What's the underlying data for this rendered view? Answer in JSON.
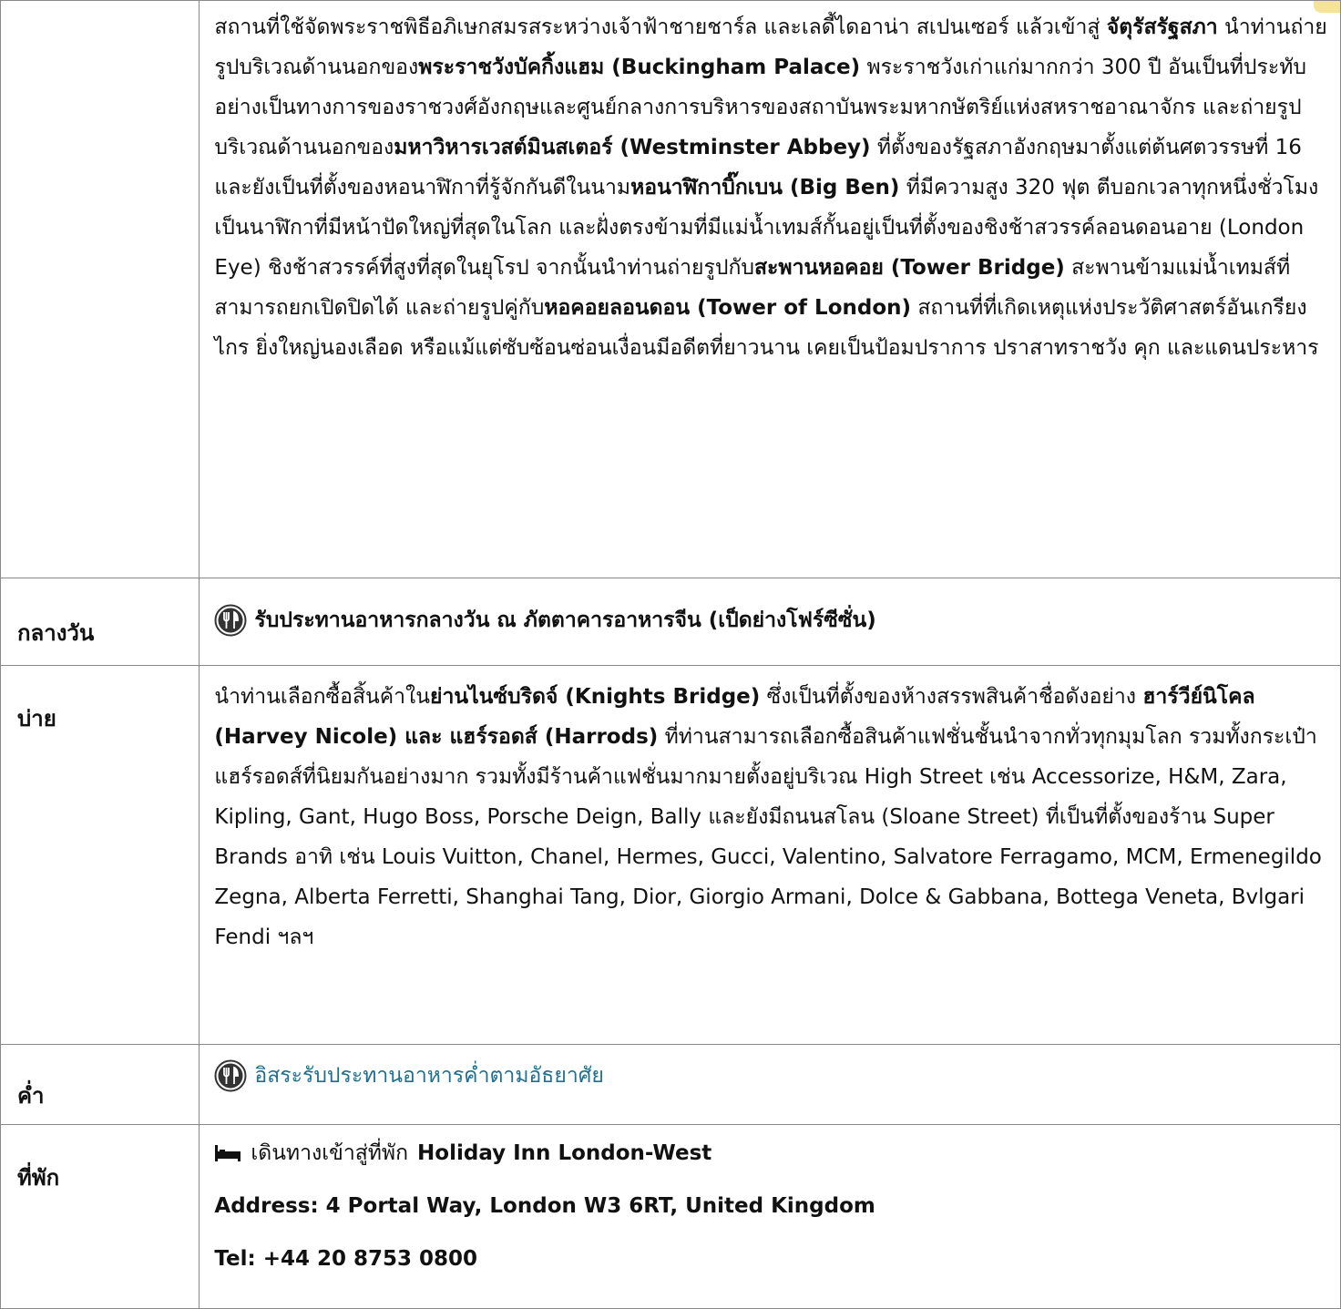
{
  "colors": {
    "border": "#8a8a8a",
    "dinner_link": "#1f6f91",
    "corner_tab": "#f6e39a"
  },
  "rows": {
    "morning": {
      "label": "",
      "segments": [
        {
          "text": "สถานที่ใช้จัดพระราชพิธีอภิเษกสมรสระหว่างเจ้าฟ้าชายชาร์ล และเลดี้ไดอาน่า สเปนเซอร์ แล้วเข้าสู่ ",
          "bold": false
        },
        {
          "text": "จัตุรัสรัฐสภา",
          "bold": true
        },
        {
          "text": " นำท่านถ่ายรูปบริเวณด้านนอกของ",
          "bold": false
        },
        {
          "text": "พระราชวังบัคกิ้งแฮม (Buckingham Palace)",
          "bold": true
        },
        {
          "text": " พระราชวังเก่าแก่มากกว่า 300 ปี อันเป็นที่ประทับอย่างเป็นทางการของราชวงศ์อังกฤษและศูนย์กลางการบริหารของสถาบันพระมหากษัตริย์แห่งสหราชอาณาจักร และถ่ายรูปบริเวณด้านนอกของ",
          "bold": false
        },
        {
          "text": "มหาวิหารเวสต์มินสเตอร์ (Westminster Abbey)",
          "bold": true
        },
        {
          "text": " ที่ตั้งของรัฐสภาอังกฤษมาตั้งแต่ต้นศตวรรษที่ 16 และยังเป็นที่ตั้งของหอนาฬิกาที่รู้จักกันดีในนาม",
          "bold": false
        },
        {
          "text": "หอนาฬิกาบิ๊กเบน (Big Ben)",
          "bold": true
        },
        {
          "text": " ที่มีความสูง 320 ฟุต ตีบอกเวลาทุกหนึ่งชั่วโมง เป็นนาฬิกาที่มีหน้าปัดใหญ่ที่สุดในโลก และฝั่งตรงข้ามที่มีแม่น้ำเทมส์กั้นอยู่เป็นที่ตั้งของชิงช้าสวรรค์ลอนดอนอาย (London Eye) ชิงช้าสวรรค์ที่สูงที่สุดในยุโรป จากนั้นนำท่านถ่ายรูปกับ",
          "bold": false
        },
        {
          "text": "สะพานหอคอย (Tower Bridge)",
          "bold": true
        },
        {
          "text": " สะพานข้ามแม่น้ำเทมส์ที่สามารถยกเปิดปิดได้ และถ่ายรูปคู่กับ",
          "bold": false
        },
        {
          "text": "หอคอยลอนดอน (Tower of London)",
          "bold": true
        },
        {
          "text": " สถานที่ที่เกิดเหตุแห่งประวัติศาสตร์อันเกรียงไกร ยิ่งใหญ่นองเลือด หรือแม้แต่ซับซ้อนซ่อนเงื่อนมีอดีตที่ยาวนาน เคยเป็นป้อมปราการ ปราสาทราชวัง คุก และแดนประหาร",
          "bold": false
        }
      ]
    },
    "lunch": {
      "label": "กลางวัน",
      "icon": "restaurant-icon",
      "text": "รับประทานอาหารกลางวัน ณ ภัตตาคารอาหารจีน (เป็ดย่างโฟร์ซีซั่น)"
    },
    "afternoon": {
      "label": "บ่าย",
      "segments": [
        {
          "text": "นำท่านเลือกซื้อสิ้นค้าใน",
          "bold": false
        },
        {
          "text": "ย่านไนซ์บริดจ์ (Knights Bridge)",
          "bold": true
        },
        {
          "text": " ซึ่งเป็นที่ตั้งของห้างสรรพสินค้าชื่อดังอย่าง ",
          "bold": false
        },
        {
          "text": "ฮาร์วีย์นิโคล (Harvey Nicole) และ แฮร์รอดส์ (Harrods)",
          "bold": true
        },
        {
          "text": " ที่ท่านสามารถเลือกซื้อสินค้าแฟชั่นชั้นนำจากทั่วทุกมุมโลก รวมทั้งกระเป๋าแฮร์รอดส์ที่นิยมกันอย่างมาก รวมทั้งมีร้านค้าแฟชั่นมากมายตั้งอยู่บริเวณ High Street เช่น Accessorize, H&M, Zara, Kipling, Gant, Hugo Boss, Porsche Deign, Bally และยังมีถนนสโลน (Sloane Street) ที่เป็นที่ตั้งของร้าน Super Brands อาทิ เช่น Louis Vuitton, Chanel, Hermes, Gucci, Valentino, Salvatore Ferragamo, MCM, Ermenegildo Zegna, Alberta Ferretti, Shanghai Tang, Dior, Giorgio Armani, Dolce & Gabbana, Bottega Veneta, Bvlgari Fendi ฯลฯ",
          "bold": false
        }
      ]
    },
    "dinner": {
      "label": "ค่ำ",
      "icon": "restaurant-icon",
      "text": "อิสระรับประทานอาหารค่ำตามอัธยาศัย"
    },
    "hotel": {
      "label": "ที่พัก",
      "icon": "bed-icon",
      "intro": "เดินทางเข้าสู่ที่พัก",
      "name": "Holiday Inn London-West",
      "address": "Address: 4 Portal Way, London W3 6RT, United Kingdom",
      "tel": "Tel: +44 20 8753 0800"
    }
  }
}
